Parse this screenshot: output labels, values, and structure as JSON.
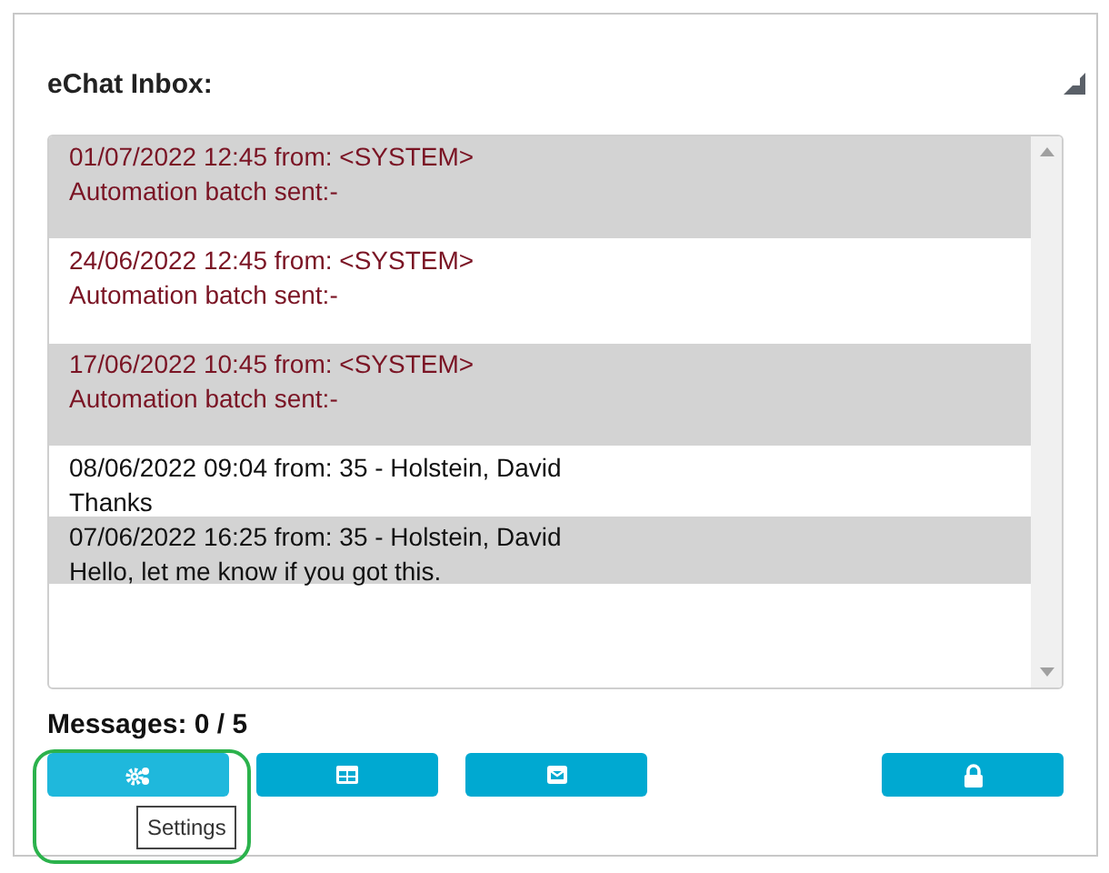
{
  "panel": {
    "title": "eChat Inbox:"
  },
  "messages": [
    {
      "kind": "system",
      "shaded": true,
      "header": "01/07/2022 12:45 from: <SYSTEM>",
      "body": "Automation batch sent:-"
    },
    {
      "kind": "system",
      "shaded": false,
      "header": "24/06/2022 12:45 from: <SYSTEM>",
      "body": "Automation batch sent:-"
    },
    {
      "kind": "system",
      "shaded": true,
      "header": "17/06/2022 10:45 from: <SYSTEM>",
      "body": "Automation batch sent:-"
    },
    {
      "kind": "user",
      "shaded": false,
      "header": "08/06/2022 09:04 from: 35 - Holstein, David",
      "body": "Thanks"
    },
    {
      "kind": "user",
      "shaded": true,
      "header": "07/06/2022 16:25 from: 35 - Holstein, David",
      "body": "Hello, let me know if you got this."
    }
  ],
  "counter": "Messages: 0 / 5",
  "buttons": [
    {
      "kind": "settings",
      "hovered": true
    },
    {
      "kind": "grid",
      "hovered": false
    },
    {
      "kind": "mail",
      "hovered": false
    },
    {
      "kind": "lock",
      "hovered": false
    }
  ],
  "tooltip": "Settings"
}
